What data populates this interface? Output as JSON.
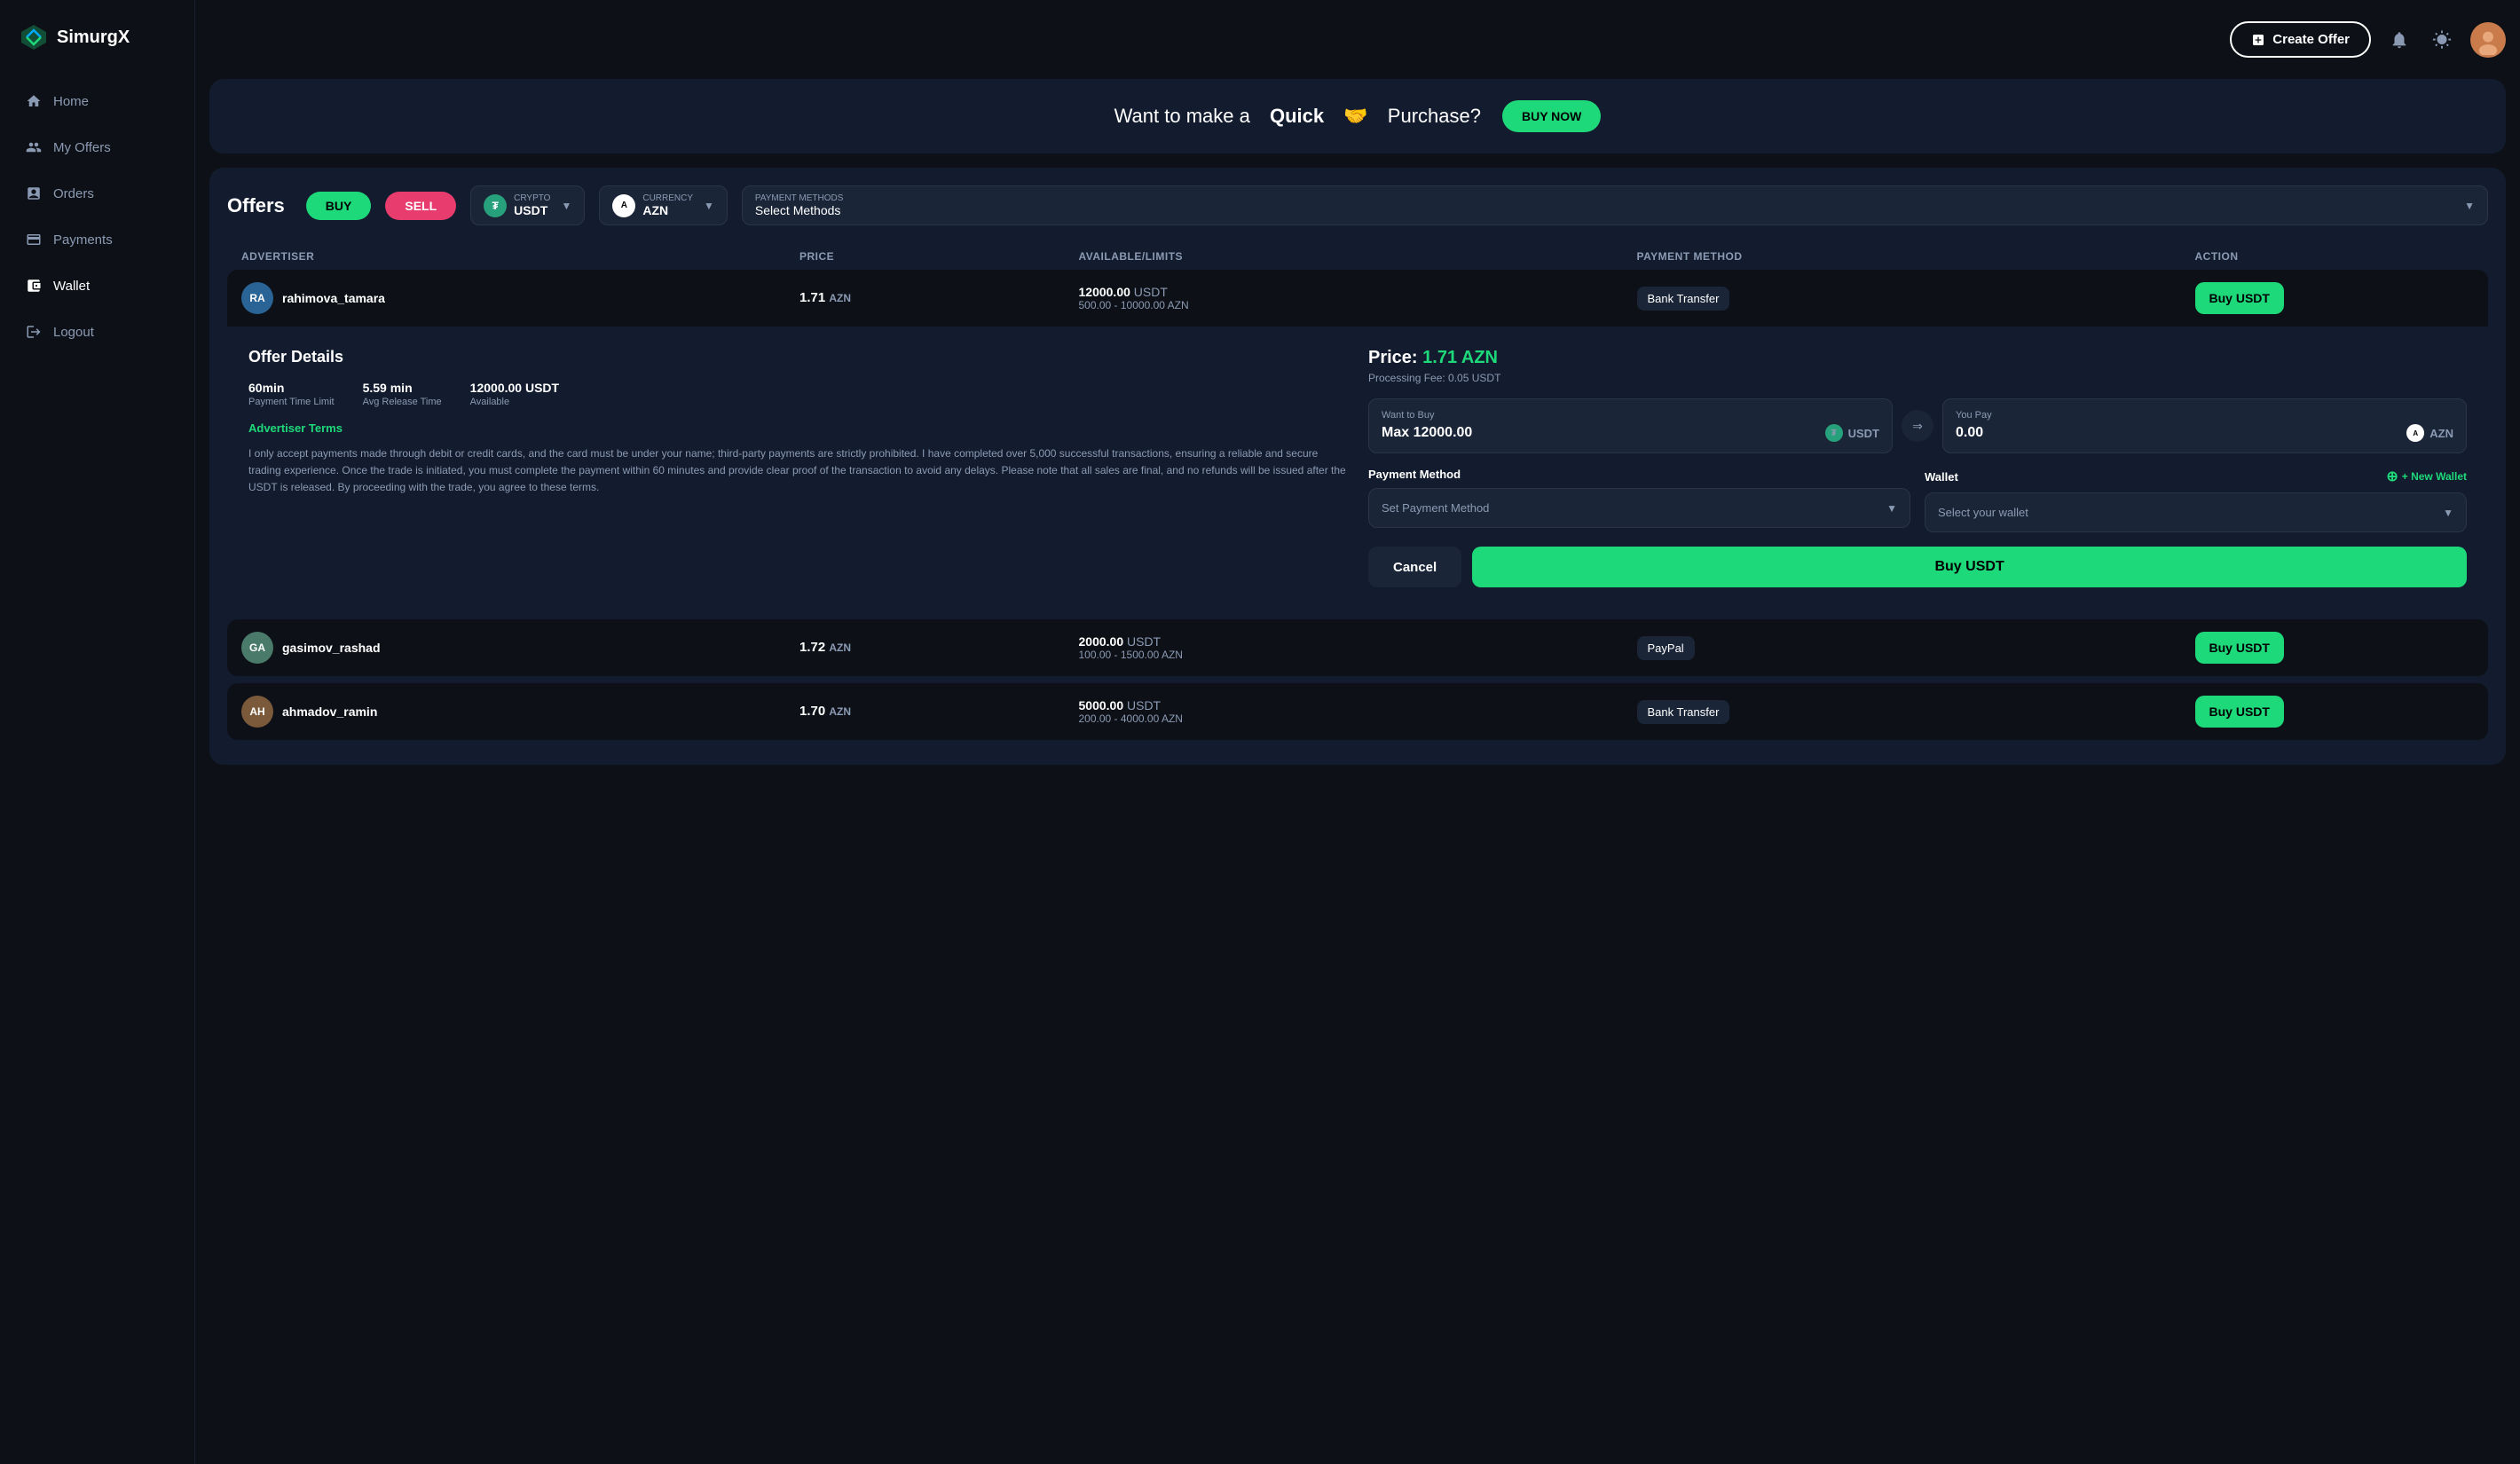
{
  "app": {
    "logo_text": "SimurgX"
  },
  "header": {
    "create_offer_label": "Create Offer",
    "notification_icon": "bell",
    "theme_icon": "sun"
  },
  "banner": {
    "prefix": "Want to make a",
    "bold_text": "Quick",
    "emoji": "🤝",
    "suffix": "Purchase?",
    "btn_label": "BUY NOW"
  },
  "sidebar": {
    "items": [
      {
        "id": "home",
        "label": "Home",
        "icon": "home"
      },
      {
        "id": "my-offers",
        "label": "My Offers",
        "icon": "offers"
      },
      {
        "id": "orders",
        "label": "Orders",
        "icon": "orders"
      },
      {
        "id": "payments",
        "label": "Payments",
        "icon": "payments"
      },
      {
        "id": "wallet",
        "label": "Wallet",
        "icon": "wallet",
        "active": true
      },
      {
        "id": "logout",
        "label": "Logout",
        "icon": "logout"
      }
    ]
  },
  "offers": {
    "title": "Offers",
    "buy_label": "BUY",
    "sell_label": "SELL",
    "crypto": {
      "value": "USDT",
      "icon_text": "₮",
      "label": "CRYPTO"
    },
    "currency": {
      "value": "AZN",
      "icon_text": "A",
      "label": "CURRENCY"
    },
    "payment_methods": {
      "label": "PAYMENT METHODS",
      "placeholder": "Select Methods"
    },
    "table_headers": [
      "ADVERTISER",
      "PRICE",
      "AVAILABLE/LIMITS",
      "PAYMENT METHOD",
      "ACTION"
    ],
    "rows": [
      {
        "id": "row1",
        "initials": "RA",
        "username": "rahimova_tamara",
        "price": "1.71",
        "currency": "AZN",
        "available": "12000.00",
        "available_unit": "USDT",
        "limit_min": "500.00",
        "limit_max": "10000.00",
        "limit_unit": "AZN",
        "payment_method": "Bank Transfer",
        "action_label": "Buy",
        "action_unit": "USDT",
        "expanded": true,
        "avatar_bg": "#2a6496"
      },
      {
        "id": "row2",
        "initials": "GA",
        "username": "gasimov_rashad",
        "price": "1.72",
        "currency": "AZN",
        "available": "2000.00",
        "available_unit": "USDT",
        "limit_min": "100.00",
        "limit_max": "1500.00",
        "limit_unit": "AZN",
        "payment_method": "PayPal",
        "action_label": "Buy",
        "action_unit": "USDT",
        "expanded": false,
        "avatar_bg": "#4a7a6a"
      },
      {
        "id": "row3",
        "initials": "AH",
        "username": "ahmadov_ramin",
        "price": "1.70",
        "currency": "AZN",
        "available": "5000.00",
        "available_unit": "USDT",
        "limit_min": "200.00",
        "limit_max": "4000.00",
        "limit_unit": "AZN",
        "payment_method": "Bank Transfer",
        "action_label": "Buy",
        "action_unit": "USDT",
        "expanded": false,
        "avatar_bg": "#7a5a3a"
      }
    ]
  },
  "offer_detail": {
    "title": "Offer Details",
    "stats": [
      {
        "value": "60min",
        "label": "Payment Time Limit"
      },
      {
        "value": "5.59 min",
        "label": "Avg Release Time"
      },
      {
        "value": "12000.00 USDT",
        "label": "Available"
      }
    ],
    "terms_title": "Advertiser Terms",
    "terms_text": "I only accept payments made through debit or credit cards, and the card must be under your name; third-party payments are strictly prohibited. I have completed over 5,000 successful transactions, ensuring a reliable and secure trading experience. Once the trade is initiated, you must complete the payment within 60 minutes and provide clear proof of the transaction to avoid any delays. Please note that all sales are final, and no refunds will be issued after the USDT is released. By proceeding with the trade, you agree to these terms.",
    "price_label": "Price:",
    "price_value": "1.71 AZN",
    "processing_fee": "Processing Fee: 0.05 USDT",
    "want_to_buy_label": "Want to Buy",
    "want_to_buy_value": "Max 12000.00",
    "want_to_buy_unit": "USDT",
    "you_pay_label": "You Pay",
    "you_pay_value": "0.00",
    "you_pay_unit": "AZN",
    "payment_method_label": "Payment Method",
    "payment_method_placeholder": "Set Payment Method",
    "wallet_label": "Wallet",
    "wallet_placeholder": "Select your wallet",
    "new_wallet_label": "+ New Wallet",
    "cancel_label": "Cancel",
    "buy_label": "Buy",
    "buy_unit": "USDT"
  }
}
